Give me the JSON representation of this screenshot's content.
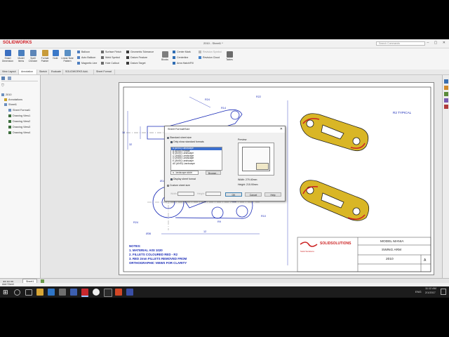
{
  "app": {
    "brand": "SOLIDWORKS",
    "document_title": "2010 - Sheet1 *",
    "search_placeholder": "Search Commands",
    "window_controls": "–  ▢  ✕"
  },
  "ribbon": {
    "big_buttons": [
      {
        "label": "Smart Dimension",
        "icon": "smart-dimension-icon",
        "color": "#3b6fc0"
      },
      {
        "label": "Model Items",
        "icon": "model-items-icon",
        "color": "#4a7fbf"
      },
      {
        "label": "Spell Checker",
        "icon": "spell-checker-icon",
        "color": "#5d86b8"
      },
      {
        "label": "Format Painter",
        "icon": "format-painter-icon",
        "color": "#c89b3a"
      },
      {
        "label": "Note",
        "icon": "note-icon",
        "color": "#3a78c8"
      },
      {
        "label": "Linear Note Pattern",
        "icon": "linear-note-pattern-icon",
        "color": "#5a8fc4"
      }
    ],
    "small_col1": [
      "Balloon",
      "Auto Balloon",
      "Magnetic Line"
    ],
    "small_col2": [
      "Surface Finish",
      "Weld Symbol",
      "Hole Callout"
    ],
    "small_col3": [
      "Geometric Tolerance",
      "Datum Feature",
      "Datum Target"
    ],
    "blocks_label": "Blocks",
    "small_col4": [
      "Center Mark",
      "Centerline",
      "Area Hatch/Fill"
    ],
    "small_col5": [
      "Revision Symbol",
      "Revision Cloud"
    ],
    "tables_label": "Tables"
  },
  "command_tabs": [
    "View Layout",
    "Annotation",
    "Sketch",
    "Evaluate",
    "SOLIDWORKS Add-Ins",
    "Sheet Format"
  ],
  "active_tab": "Annotation",
  "tree": {
    "root": "2010",
    "items": [
      "Annotations",
      "Sheet1",
      "Sheet Format1",
      "Drawing View1",
      "Drawing View2",
      "Drawing View3",
      "Drawing View4"
    ]
  },
  "drawing": {
    "dims": [
      "R24",
      "R14",
      "R22",
      "R2 TYPICAL",
      "14",
      "32",
      "R8",
      "R12",
      "R10",
      "R24",
      "Ø36",
      "Ø14",
      "R12",
      "R18",
      "R9",
      "12"
    ],
    "notes": [
      "NOTES:",
      "1.    MATERIAL AISI 1020",
      "2.    FILLETS COLOURED RED - R2",
      "3.    RED 2mm FILLETS REMOVED FROM",
      "       ORTHOGRAPHIC VIEWS FOR CLARITY"
    ],
    "title_block": {
      "company": "SOLIDSOLUTIONS",
      "tagline": "Solid Solutions",
      "project": "MODEL MANIA",
      "title": "SWING ARM",
      "number": "2010",
      "size": "A"
    }
  },
  "dialog": {
    "title": "Sheet Format/Size",
    "close": "✕",
    "radio_standard": "Standard sheet size",
    "check_only_standard": "Only show standard formats",
    "formats": [
      "A (ANSI) Landscape",
      "A (ANSI) Portrait",
      "B (ANSI) Landscape",
      "C (ANSI) Landscape",
      "D (ANSI) Landscape",
      "E (ANSI) Landscape",
      "A0 (ANSI) Landscape"
    ],
    "selected_index": 0,
    "format_file": "a - landscape.slddrt",
    "browse": "Browse...",
    "check_display_format": "Display sheet format",
    "radio_custom": "Custom sheet size",
    "width_label": "Width:",
    "height_label": "Height:",
    "preview_label": "Preview",
    "preview_width": "Width:   279.40mm",
    "preview_height": "Height:   215.90mm",
    "ok": "OK",
    "cancel": "Cancel",
    "help": "Help"
  },
  "sheet_tab": "Sheet1",
  "status": "Add Sheet",
  "clock": {
    "time": "11:12 AM",
    "date": "2/1/2017"
  },
  "tray": {
    "lang": "ENG"
  },
  "colors": {
    "accent": "#3b6fcf",
    "annotation_blue": "#1a2bb7",
    "brand_red": "#d01f26"
  }
}
